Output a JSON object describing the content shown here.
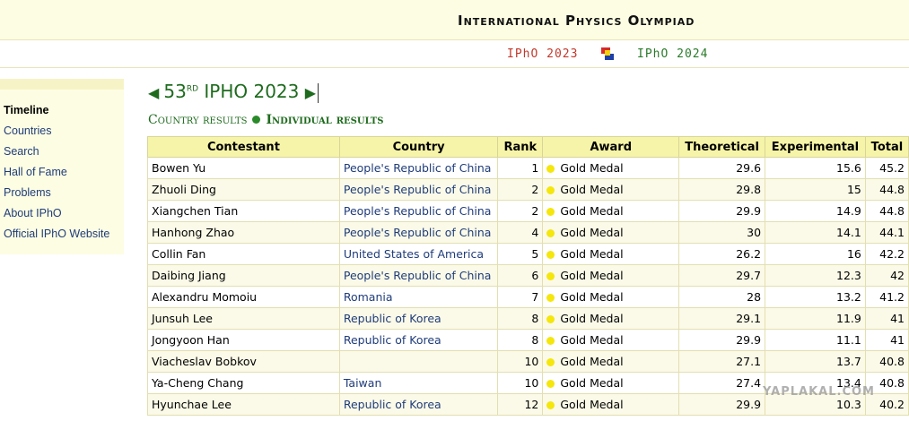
{
  "header": {
    "title": "International Physics Olympiad"
  },
  "nav": {
    "prev": "IPhO 2023",
    "next": "IPhO 2024",
    "logo_colors": [
      "#d62b2b",
      "#1e3fa8",
      "#f2d20c"
    ]
  },
  "sidebar": {
    "items": [
      {
        "label": "Timeline",
        "active": true
      },
      {
        "label": "Countries"
      },
      {
        "label": "Search"
      },
      {
        "label": "Hall of Fame"
      },
      {
        "label": "Problems"
      },
      {
        "label": "About IPhO"
      },
      {
        "label": "Official IPhO Website"
      }
    ]
  },
  "heading": {
    "prefix": "◀ ",
    "ordinal": "53",
    "suffix": "RD",
    "text": " IPHO 2023 ",
    "next_arrow": "▶"
  },
  "subnav": {
    "country": "Country results",
    "individual": "Individual results"
  },
  "table": {
    "columns": [
      "Contestant",
      "Country",
      "Rank",
      "Award",
      "Theoretical",
      "Experimental",
      "Total"
    ],
    "rows": [
      {
        "contestant": "Bowen Yu",
        "country": "People's Republic of China",
        "rank": "1",
        "award": "Gold Medal",
        "theoretical": "29.6",
        "experimental": "15.6",
        "total": "45.2"
      },
      {
        "contestant": "Zhuoli Ding",
        "country": "People's Republic of China",
        "rank": "2",
        "award": "Gold Medal",
        "theoretical": "29.8",
        "experimental": "15",
        "total": "44.8"
      },
      {
        "contestant": "Xiangchen Tian",
        "country": "People's Republic of China",
        "rank": "2",
        "award": "Gold Medal",
        "theoretical": "29.9",
        "experimental": "14.9",
        "total": "44.8"
      },
      {
        "contestant": "Hanhong Zhao",
        "country": "People's Republic of China",
        "rank": "4",
        "award": "Gold Medal",
        "theoretical": "30",
        "experimental": "14.1",
        "total": "44.1"
      },
      {
        "contestant": "Collin Fan",
        "country": "United States of America",
        "rank": "5",
        "award": "Gold Medal",
        "theoretical": "26.2",
        "experimental": "16",
        "total": "42.2"
      },
      {
        "contestant": "Daibing Jiang",
        "country": "People's Republic of China",
        "rank": "6",
        "award": "Gold Medal",
        "theoretical": "29.7",
        "experimental": "12.3",
        "total": "42"
      },
      {
        "contestant": "Alexandru Momoiu",
        "country": "Romania",
        "rank": "7",
        "award": "Gold Medal",
        "theoretical": "28",
        "experimental": "13.2",
        "total": "41.2"
      },
      {
        "contestant": "Junsuh Lee",
        "country": "Republic of Korea",
        "rank": "8",
        "award": "Gold Medal",
        "theoretical": "29.1",
        "experimental": "11.9",
        "total": "41"
      },
      {
        "contestant": "Jongyoon Han",
        "country": "Republic of Korea",
        "rank": "8",
        "award": "Gold Medal",
        "theoretical": "29.9",
        "experimental": "11.1",
        "total": "41"
      },
      {
        "contestant": "Viacheslav Bobkov",
        "country": "",
        "rank": "10",
        "award": "Gold Medal",
        "theoretical": "27.1",
        "experimental": "13.7",
        "total": "40.8"
      },
      {
        "contestant": "Ya-Cheng Chang",
        "country": "Taiwan",
        "rank": "10",
        "award": "Gold Medal",
        "theoretical": "27.4",
        "experimental": "13.4",
        "total": "40.8"
      },
      {
        "contestant": "Hyunchae Lee",
        "country": "Republic of Korea",
        "rank": "12",
        "award": "Gold Medal",
        "theoretical": "29.9",
        "experimental": "10.3",
        "total": "40.2"
      }
    ]
  },
  "watermark": "YAPLAKAL.COM"
}
